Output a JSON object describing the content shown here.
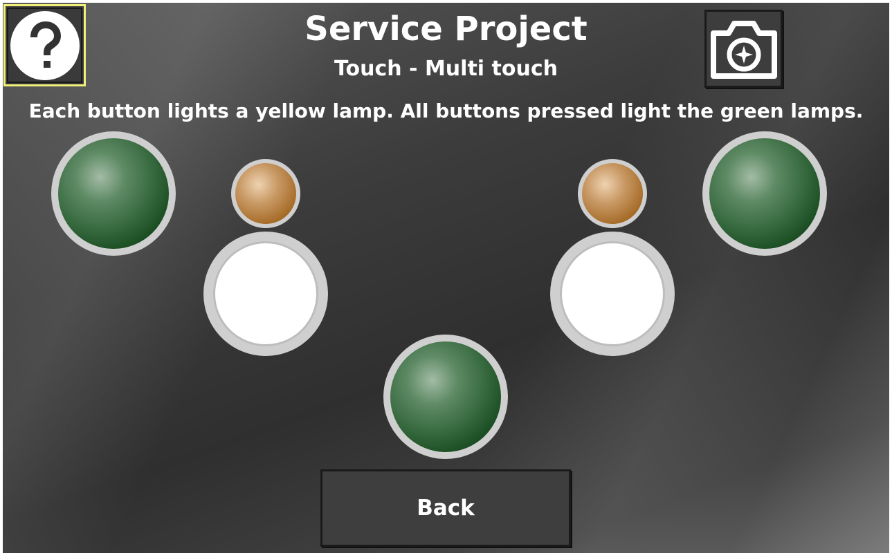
{
  "header": {
    "title": "Service Project",
    "subtitle": "Touch - Multi touch"
  },
  "instructions": "Each button lights a yellow lamp. All buttons pressed light the green lamps.",
  "toolbar": {
    "help_icon": "question-mark-icon",
    "camera_icon": "camera-icon"
  },
  "lamps": {
    "green": {
      "color": "#1f5a28",
      "count": 3,
      "state": "off"
    },
    "yellow": {
      "color": "#a56a26",
      "count": 2,
      "state": "off"
    }
  },
  "touch_buttons": {
    "count": 2,
    "color": "#ffffff"
  },
  "footer": {
    "back_label": "Back"
  }
}
